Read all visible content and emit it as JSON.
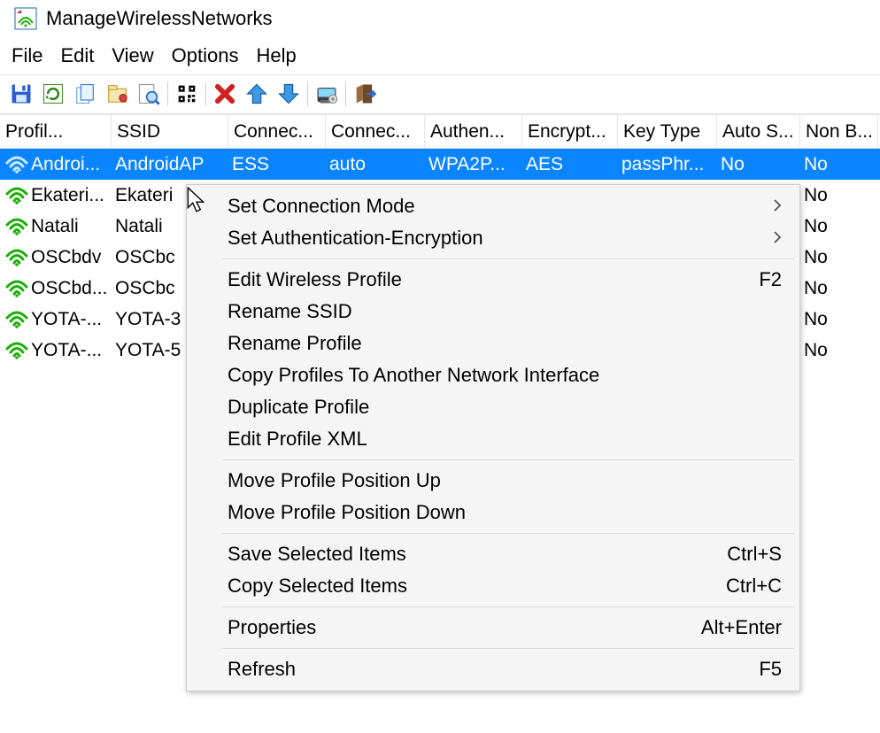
{
  "title": "ManageWirelessNetworks",
  "menubar": [
    "File",
    "Edit",
    "View",
    "Options",
    "Help"
  ],
  "toolbar_icons": [
    "save",
    "refresh",
    "copy",
    "properties",
    "find",
    "qr",
    "delete",
    "up",
    "down",
    "options",
    "exit"
  ],
  "columns": [
    "Profil...",
    "SSID",
    "Connec...",
    "Connec...",
    "Authen...",
    "Encrypt...",
    "Key Type",
    "Auto S...",
    "Non B..."
  ],
  "rows": [
    {
      "selected": true,
      "wifi_color": "#0a5d8a",
      "profile": "Androi...",
      "ssid": "AndroidAP",
      "c1": "ESS",
      "c2": "auto",
      "auth": "WPA2P...",
      "enc": "AES",
      "key": "passPhr...",
      "autos": "No",
      "nonb": "No"
    },
    {
      "selected": false,
      "wifi_color": "#18b000",
      "profile": "Ekateri...",
      "ssid": "Ekateri",
      "c1": "",
      "c2": "",
      "auth": "",
      "enc": "",
      "key": "",
      "autos": "",
      "nonb": "No"
    },
    {
      "selected": false,
      "wifi_color": "#18b000",
      "profile": "Natali",
      "ssid": "Natali",
      "c1": "",
      "c2": "",
      "auth": "",
      "enc": "",
      "key": "",
      "autos": "",
      "nonb": "No"
    },
    {
      "selected": false,
      "wifi_color": "#18b000",
      "profile": "OSCbdv",
      "ssid": "OSCbc",
      "c1": "",
      "c2": "",
      "auth": "",
      "enc": "",
      "key": "",
      "autos": "",
      "nonb": "No"
    },
    {
      "selected": false,
      "wifi_color": "#18b000",
      "profile": "OSCbd...",
      "ssid": "OSCbc",
      "c1": "",
      "c2": "",
      "auth": "",
      "enc": "",
      "key": "",
      "autos": "",
      "nonb": "No"
    },
    {
      "selected": false,
      "wifi_color": "#18b000",
      "profile": "YOTA-...",
      "ssid": "YOTA-3",
      "c1": "",
      "c2": "",
      "auth": "",
      "enc": "",
      "key": "",
      "autos": "",
      "nonb": "No"
    },
    {
      "selected": false,
      "wifi_color": "#18b000",
      "profile": "YOTA-...",
      "ssid": "YOTA-5",
      "c1": "",
      "c2": "",
      "auth": "",
      "enc": "",
      "key": "",
      "autos": "",
      "nonb": "No"
    }
  ],
  "context_menu": [
    {
      "type": "item",
      "label": "Set Connection Mode",
      "submenu": true
    },
    {
      "type": "item",
      "label": "Set Authentication-Encryption",
      "submenu": true
    },
    {
      "type": "sep"
    },
    {
      "type": "item",
      "label": "Edit Wireless Profile",
      "shortcut": "F2"
    },
    {
      "type": "item",
      "label": "Rename SSID"
    },
    {
      "type": "item",
      "label": "Rename Profile"
    },
    {
      "type": "item",
      "label": "Copy Profiles To Another Network Interface"
    },
    {
      "type": "item",
      "label": "Duplicate Profile"
    },
    {
      "type": "item",
      "label": "Edit Profile XML"
    },
    {
      "type": "sep"
    },
    {
      "type": "item",
      "label": "Move Profile Position Up"
    },
    {
      "type": "item",
      "label": "Move Profile Position Down"
    },
    {
      "type": "sep"
    },
    {
      "type": "item",
      "label": "Save Selected Items",
      "shortcut": "Ctrl+S"
    },
    {
      "type": "item",
      "label": "Copy Selected Items",
      "shortcut": "Ctrl+C"
    },
    {
      "type": "sep"
    },
    {
      "type": "item",
      "label": "Properties",
      "shortcut": "Alt+Enter"
    },
    {
      "type": "sep"
    },
    {
      "type": "item",
      "label": "Refresh",
      "shortcut": "F5"
    }
  ]
}
